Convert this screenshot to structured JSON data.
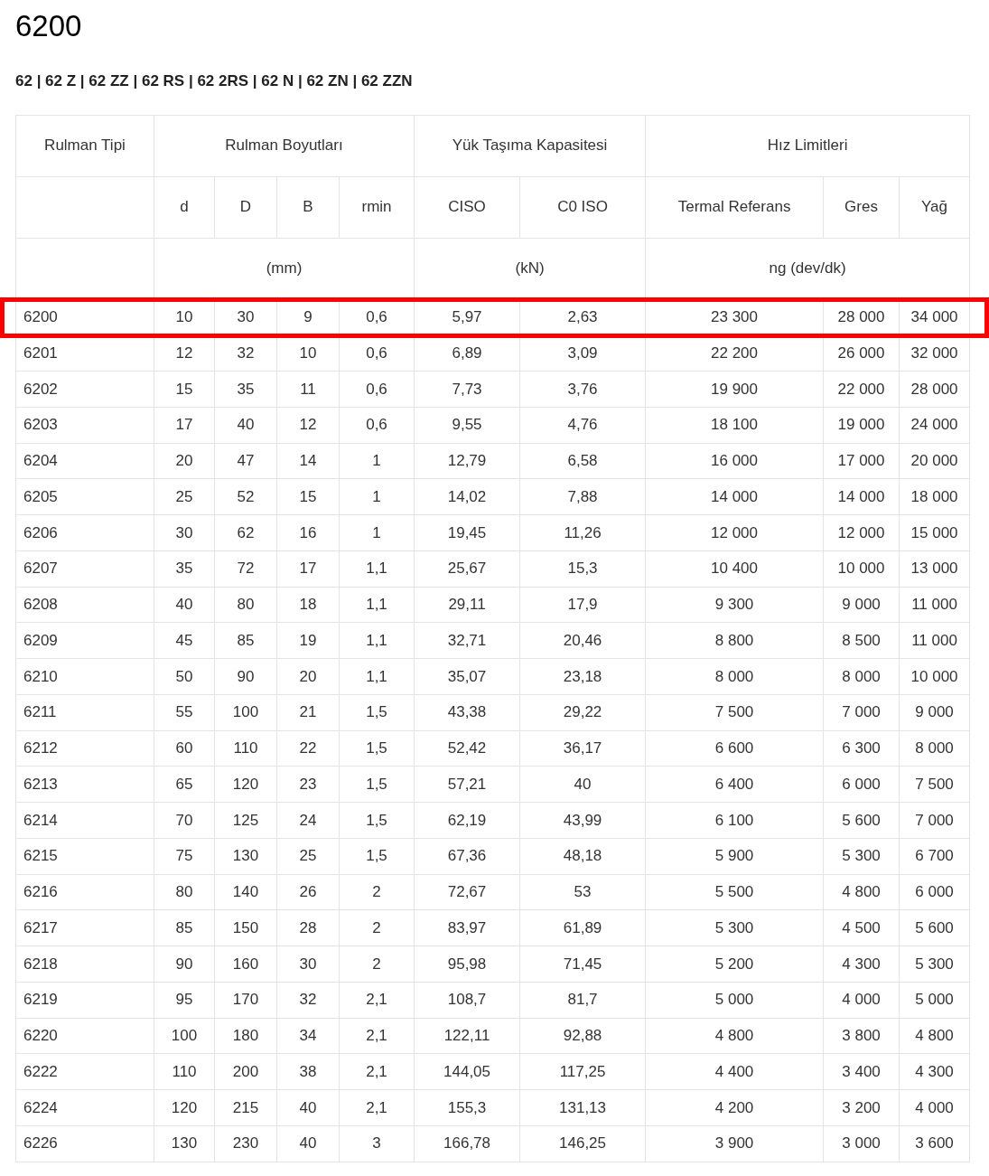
{
  "title": "6200",
  "subtitle": "62 | 62 Z | 62 ZZ | 62 RS | 62 2RS | 62 N | 62 ZN | 62 ZZN",
  "group_headers": [
    "Rulman Tipi",
    "Rulman Boyutları",
    "Yük Taşıma Kapasitesi",
    "Hız Limitleri"
  ],
  "columns": [
    "d",
    "D",
    "B",
    "rmin",
    "CISO",
    "C0 ISO",
    "Termal Referans",
    "Gres",
    "Yağ"
  ],
  "units": [
    "(mm)",
    "(kN)",
    "ng (dev/dk)"
  ],
  "rows": [
    {
      "cells": [
        "6200",
        "10",
        "30",
        "9",
        "0,6",
        "5,97",
        "2,63",
        "23 300",
        "28 000",
        "34 000"
      ],
      "selected": true
    },
    {
      "cells": [
        "6201",
        "12",
        "32",
        "10",
        "0,6",
        "6,89",
        "3,09",
        "22 200",
        "26 000",
        "32 000"
      ],
      "selected": false
    },
    {
      "cells": [
        "6202",
        "15",
        "35",
        "11",
        "0,6",
        "7,73",
        "3,76",
        "19 900",
        "22 000",
        "28 000"
      ],
      "selected": false
    },
    {
      "cells": [
        "6203",
        "17",
        "40",
        "12",
        "0,6",
        "9,55",
        "4,76",
        "18 100",
        "19 000",
        "24 000"
      ],
      "selected": false
    },
    {
      "cells": [
        "6204",
        "20",
        "47",
        "14",
        "1",
        "12,79",
        "6,58",
        "16 000",
        "17 000",
        "20 000"
      ],
      "selected": false
    },
    {
      "cells": [
        "6205",
        "25",
        "52",
        "15",
        "1",
        "14,02",
        "7,88",
        "14 000",
        "14 000",
        "18 000"
      ],
      "selected": false
    },
    {
      "cells": [
        "6206",
        "30",
        "62",
        "16",
        "1",
        "19,45",
        "11,26",
        "12 000",
        "12 000",
        "15 000"
      ],
      "selected": false
    },
    {
      "cells": [
        "6207",
        "35",
        "72",
        "17",
        "1,1",
        "25,67",
        "15,3",
        "10 400",
        "10 000",
        "13 000"
      ],
      "selected": false
    },
    {
      "cells": [
        "6208",
        "40",
        "80",
        "18",
        "1,1",
        "29,11",
        "17,9",
        "9 300",
        "9 000",
        "11 000"
      ],
      "selected": false
    },
    {
      "cells": [
        "6209",
        "45",
        "85",
        "19",
        "1,1",
        "32,71",
        "20,46",
        "8 800",
        "8 500",
        "11 000"
      ],
      "selected": false
    },
    {
      "cells": [
        "6210",
        "50",
        "90",
        "20",
        "1,1",
        "35,07",
        "23,18",
        "8 000",
        "8 000",
        "10 000"
      ],
      "selected": false
    },
    {
      "cells": [
        "6211",
        "55",
        "100",
        "21",
        "1,5",
        "43,38",
        "29,22",
        "7 500",
        "7 000",
        "9 000"
      ],
      "selected": false
    },
    {
      "cells": [
        "6212",
        "60",
        "110",
        "22",
        "1,5",
        "52,42",
        "36,17",
        "6 600",
        "6 300",
        "8 000"
      ],
      "selected": false
    },
    {
      "cells": [
        "6213",
        "65",
        "120",
        "23",
        "1,5",
        "57,21",
        "40",
        "6 400",
        "6 000",
        "7 500"
      ],
      "selected": false
    },
    {
      "cells": [
        "6214",
        "70",
        "125",
        "24",
        "1,5",
        "62,19",
        "43,99",
        "6 100",
        "5 600",
        "7 000"
      ],
      "selected": false
    },
    {
      "cells": [
        "6215",
        "75",
        "130",
        "25",
        "1,5",
        "67,36",
        "48,18",
        "5 900",
        "5 300",
        "6 700"
      ],
      "selected": false
    },
    {
      "cells": [
        "6216",
        "80",
        "140",
        "26",
        "2",
        "72,67",
        "53",
        "5 500",
        "4 800",
        "6 000"
      ],
      "selected": false
    },
    {
      "cells": [
        "6217",
        "85",
        "150",
        "28",
        "2",
        "83,97",
        "61,89",
        "5 300",
        "4 500",
        "5 600"
      ],
      "selected": false
    },
    {
      "cells": [
        "6218",
        "90",
        "160",
        "30",
        "2",
        "95,98",
        "71,45",
        "5 200",
        "4 300",
        "5 300"
      ],
      "selected": false
    },
    {
      "cells": [
        "6219",
        "95",
        "170",
        "32",
        "2,1",
        "108,7",
        "81,7",
        "5 000",
        "4 000",
        "5 000"
      ],
      "selected": false
    },
    {
      "cells": [
        "6220",
        "100",
        "180",
        "34",
        "2,1",
        "122,11",
        "92,88",
        "4 800",
        "3 800",
        "4 800"
      ],
      "selected": false
    },
    {
      "cells": [
        "6222",
        "110",
        "200",
        "38",
        "2,1",
        "144,05",
        "117,25",
        "4 400",
        "3 400",
        "4 300"
      ],
      "selected": false
    },
    {
      "cells": [
        "6224",
        "120",
        "215",
        "40",
        "2,1",
        "155,3",
        "131,13",
        "4 200",
        "3 200",
        "4 000"
      ],
      "selected": false
    },
    {
      "cells": [
        "6226",
        "130",
        "230",
        "40",
        "3",
        "166,78",
        "146,25",
        "3 900",
        "3 000",
        "3 600"
      ],
      "selected": false
    }
  ]
}
